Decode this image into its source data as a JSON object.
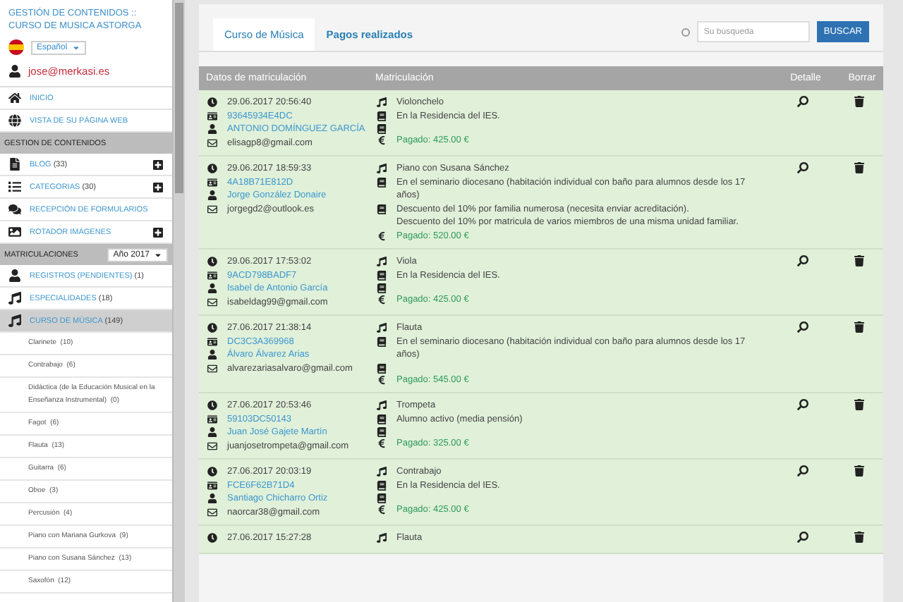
{
  "sidebar": {
    "title": "GESTIÓN DE CONTENIDOS :: CURSO DE MUSICA ASTORGA",
    "language": "Español",
    "user_email": "jose@merkasi.es",
    "items": [
      {
        "kind": "nav",
        "label": "INICIO",
        "selected": false,
        "add": false
      },
      {
        "kind": "nav",
        "label": "VISTA DE SU PÁGINA WEB",
        "selected": false,
        "add": false
      },
      {
        "kind": "header",
        "label": "GESTION DE CONTENIDOS"
      },
      {
        "kind": "nav",
        "label": "BLOG",
        "count": "(33)",
        "selected": false,
        "add": true
      },
      {
        "kind": "nav",
        "label": "CATEGORIAS",
        "count": "(30)",
        "selected": false,
        "add": true
      },
      {
        "kind": "nav",
        "label": "RECEPCIÓN DE FORMULARIOS",
        "selected": false,
        "add": false
      },
      {
        "kind": "nav",
        "label": "ROTADOR IMÁGENES",
        "selected": false,
        "add": true
      },
      {
        "kind": "header",
        "label": "MATRICULACIONES",
        "select": "Año 2017"
      },
      {
        "kind": "nav",
        "label": "REGISTROS (PENDIENTES)",
        "count": "(1)",
        "selected": false,
        "add": false
      },
      {
        "kind": "nav",
        "label": "ESPECIALIDADES",
        "count": "(18)",
        "selected": false,
        "add": false
      },
      {
        "kind": "nav",
        "label": "CURSO DE MÚSICA",
        "count": "(149)",
        "selected": true,
        "add": false
      },
      {
        "kind": "sub",
        "label": "Clarinete",
        "count": "(10)"
      },
      {
        "kind": "sub",
        "label": "Contrabajo",
        "count": "(6)"
      },
      {
        "kind": "sub",
        "label": "Didáctica (de la Educación Musical en la Enseñanza Instrumental)",
        "count": "(0)"
      },
      {
        "kind": "sub",
        "label": "Fagot",
        "count": "(6)"
      },
      {
        "kind": "sub",
        "label": "Flauta",
        "count": "(13)"
      },
      {
        "kind": "sub",
        "label": "Guitarra",
        "count": "(6)"
      },
      {
        "kind": "sub",
        "label": "Oboe",
        "count": "(3)"
      },
      {
        "kind": "sub",
        "label": "Percusión",
        "count": "(4)"
      },
      {
        "kind": "sub",
        "label": "Piano con Mariana Gurkova",
        "count": "(9)"
      },
      {
        "kind": "sub",
        "label": "Piano con Susana Sánchez",
        "count": "(13)"
      },
      {
        "kind": "sub",
        "label": "Saxofón",
        "count": "(12)"
      }
    ]
  },
  "tabs": [
    {
      "label": "Curso de Música",
      "selected": true
    },
    {
      "label": "Pagos realizados",
      "selected": false
    }
  ],
  "search": {
    "placeholder": "Su búsqueda",
    "button": "BUSCAR"
  },
  "table": {
    "columns": [
      "Datos de matriculación",
      "Matriculación",
      "Detalle",
      "Borrar"
    ],
    "rows": [
      {
        "datetime": "29.06.2017 20:56:40",
        "code": "93645934E4DC",
        "name": "ANTONIO DOMÍNGUEZ GARCÍA",
        "email": "elisagp8@gmail.com",
        "instrument": "Violonchelo",
        "lodging": "En la Residencia del IES.",
        "discounts": [],
        "paid": "Pagado: 425.00 €"
      },
      {
        "datetime": "29.06.2017 18:59:33",
        "code": "4A18B71E812D",
        "name": "Jorge González Donaire",
        "email": "jorgegd2@outlook.es",
        "instrument": "Piano con Susana Sánchez",
        "lodging": "En el seminario diocesano (habitación individual con baño para alumnos desde los 17 años)",
        "discounts": [
          "Descuento del 10% por familia numerosa (necesita enviar acreditación).",
          "Descuento del 10% por matricula de varios miembros de una misma unidad familiar."
        ],
        "paid": "Pagado: 520.00 €"
      },
      {
        "datetime": "29.06.2017 17:53:02",
        "code": "9ACD798BADF7",
        "name": "Isabel de Antonio García",
        "email": "isabeldag99@gmail.com",
        "instrument": "Viola",
        "lodging": "En la Residencia del IES.",
        "discounts": [],
        "paid": "Pagado: 425.00 €"
      },
      {
        "datetime": "27.06.2017 21:38:14",
        "code": "DC3C3A369968",
        "name": "Álvaro Álvarez Arias",
        "email": "alvarezariasalvaro@gmail.com",
        "instrument": "Flauta",
        "lodging": "En el seminario diocesano (habitación individual con baño para alumnos desde los 17 años)",
        "discounts": [],
        "paid": "Pagado: 545.00 €"
      },
      {
        "datetime": "27.06.2017 20:53:46",
        "code": "59103DC50143",
        "name": "Juan José Gajete Martín",
        "email": "juanjosetrompeta@gmail.com",
        "instrument": "Trompeta",
        "lodging": "Alumno activo (media pensión)",
        "discounts": [],
        "paid": "Pagado: 325.00 €"
      },
      {
        "datetime": "27.06.2017 20:03:19",
        "code": "FCE6F62B71D4",
        "name": "Santiago Chicharro Ortiz",
        "email": "naorcar38@gmail.com",
        "instrument": "Contrabajo",
        "lodging": "En la Residencia del IES.",
        "discounts": [],
        "paid": "Pagado: 425.00 €"
      },
      {
        "datetime": "27.06.2017 15:27:28",
        "instrument": "Flauta",
        "discounts": []
      }
    ]
  }
}
